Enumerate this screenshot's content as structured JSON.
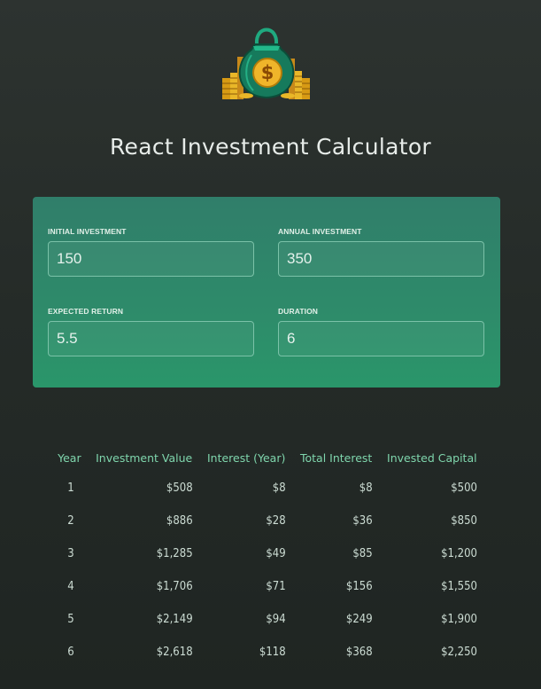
{
  "header": {
    "title": "React Investment Calculator",
    "logo_icon": "money-bag-icon"
  },
  "user_input": {
    "initial_investment": {
      "label": "Initial Investment",
      "value": "150"
    },
    "annual_investment": {
      "label": "Annual Investment",
      "value": "350"
    },
    "expected_return": {
      "label": "Expected Return",
      "value": "5.5"
    },
    "duration": {
      "label": "Duration",
      "value": "6"
    }
  },
  "results": {
    "columns": [
      "Year",
      "Investment Value",
      "Interest (Year)",
      "Total Interest",
      "Invested Capital"
    ],
    "rows": [
      [
        "1",
        "$508",
        "$8",
        "$8",
        "$500"
      ],
      [
        "2",
        "$886",
        "$28",
        "$36",
        "$850"
      ],
      [
        "3",
        "$1,285",
        "$49",
        "$85",
        "$1,200"
      ],
      [
        "4",
        "$1,706",
        "$71",
        "$156",
        "$1,550"
      ],
      [
        "5",
        "$2,149",
        "$94",
        "$249",
        "$1,900"
      ],
      [
        "6",
        "$2,618",
        "$118",
        "$368",
        "$2,250"
      ]
    ]
  },
  "colors": {
    "background": "#262c29",
    "panel": "#2e8b6a",
    "header_text": "#7fd6ad",
    "title_text": "#e7ece9",
    "coin_gold": "#e0a81e"
  }
}
